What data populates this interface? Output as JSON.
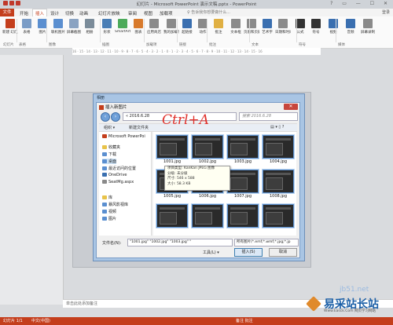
{
  "window": {
    "title": "幻灯片 - Microsoft PowerPoint 演示文稿.pptx - PowerPoint",
    "controls": "? ▭ — ☐ ✕"
  },
  "tabs": {
    "file": "文件",
    "items": [
      "开始",
      "插入",
      "设计",
      "切换",
      "动画",
      "幻灯片放映",
      "审阅",
      "视图",
      "加载项"
    ],
    "active": "插入",
    "search": "♀ 告诉我你想要做什么...",
    "login": "登录"
  },
  "ribbon": {
    "buttons": [
      {
        "label": "新建\n幻灯片",
        "color": "#c43e1c"
      },
      {
        "label": "表格",
        "color": "#7a9cc6"
      },
      {
        "label": "图片",
        "color": "#5b8fd0"
      },
      {
        "label": "联机图片",
        "color": "#5b8fd0"
      },
      {
        "label": "屏幕截图",
        "color": "#8aa3c2"
      },
      {
        "label": "相册",
        "color": "#7b8c9a"
      },
      {
        "label": "形状",
        "color": "#4a7eb5"
      },
      {
        "label": "SmartArt",
        "color": "#4caa5a"
      },
      {
        "label": "图表",
        "color": "#d87a2c"
      },
      {
        "label": "应用商店",
        "color": "#8a8a8a"
      },
      {
        "label": "我的加载项",
        "color": "#8a8a8a"
      },
      {
        "label": "超链接",
        "color": "#3a6fb0"
      },
      {
        "label": "动作",
        "color": "#8a8a8a"
      },
      {
        "label": "批注",
        "color": "#e0b043"
      },
      {
        "label": "文本框",
        "color": "#8a8a8a"
      },
      {
        "label": "页眉和页脚",
        "color": "#8a8a8a"
      },
      {
        "label": "艺术字",
        "color": "#3a6fb0"
      },
      {
        "label": "日期和时间",
        "color": "#8a8a8a"
      },
      {
        "label": "公式",
        "color": "#333333"
      },
      {
        "label": "符号",
        "color": "#333333"
      },
      {
        "label": "视频",
        "color": "#3a6fb0"
      },
      {
        "label": "音频",
        "color": "#3a6fb0"
      },
      {
        "label": "屏幕录制",
        "color": "#8a8a8a"
      }
    ],
    "groups": [
      "幻灯片",
      "表格",
      "图像",
      "插图",
      "加载项",
      "链接",
      "批注",
      "文本",
      "符号",
      "媒体"
    ]
  },
  "ruler": "16 · 15 · 14 · 13 · 12 · 11 · 10 · 9 · 8 · 7 · 6 · 5 · 4 · 3 · 2 · 1 · 0 · 1 · 2 · 3 · 4 · 5 · 6 · 7 · 8 · 9 · 10 · 11 · 12 · 13 · 14 · 15 · 16",
  "outer_dialog": {
    "title": "相册"
  },
  "dialog": {
    "title": "插入新图片",
    "close": "✕",
    "path": "« 2016.6.28",
    "search_placeholder": "搜索 2016.6.28",
    "organize": "组织 ▾",
    "new_folder": "新建文件夹",
    "tree": [
      {
        "label": "Microsoft PowerPoi",
        "icon_color": "#c43e1c"
      },
      {
        "label": "收藏夹",
        "icon_color": "#e8c34a"
      },
      {
        "label": "下载",
        "icon_color": "#5b8fd0"
      },
      {
        "label": "桌面",
        "icon_color": "#5b8fd0",
        "selected": true
      },
      {
        "label": "最近访问的位置",
        "icon_color": "#5b8fd0"
      },
      {
        "label": "OneDrive",
        "icon_color": "#3a6fb0"
      },
      {
        "label": "SeatMg.aspx",
        "icon_color": "#8a8a8a"
      },
      {
        "label": "库",
        "icon_color": "#e8c34a"
      },
      {
        "label": "暴风影视库",
        "icon_color": "#5b8fd0"
      },
      {
        "label": "视频",
        "icon_color": "#5b8fd0"
      },
      {
        "label": "图片",
        "icon_color": "#5b8fd0"
      }
    ],
    "files": [
      "1001.jpg",
      "1002.jpg",
      "1003.jpg",
      "1004.jpg",
      "1005.jpg",
      "1006.jpg",
      "1007.jpg",
      "1008.jpg",
      "",
      "",
      "",
      ""
    ],
    "tooltip": [
      "项目类型: KanKan JPEG 图像",
      "分级: 未分级",
      "尺寸: 546 x 588",
      "大小: 58.3 KB"
    ],
    "filename_label": "文件名(N):",
    "filename_value": "\"1001.jpg\" \"1002.jpg\" \"1003.jpg\" \"",
    "filter": "所有图片(*.emf;*.wmf;*.jpg;*.jp",
    "tools": "工具(L) ▾",
    "insert": "插入(S)",
    "cancel": "取消"
  },
  "annotation": "Ctrl+A",
  "notes_hint": "单击此处添加备注",
  "status": {
    "slide": "幻灯片 1/1",
    "lang": "中文(中国)",
    "right": "备注  批注"
  },
  "watermark": {
    "url": "jb51.net",
    "brand": "易采站长站",
    "sub": "Www.Easck.Com 网页学习网站"
  }
}
